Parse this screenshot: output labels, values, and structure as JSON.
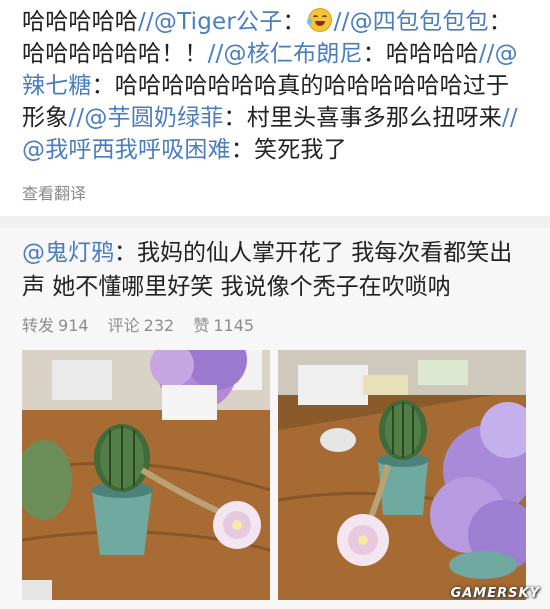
{
  "thread": {
    "parts": [
      {
        "type": "text",
        "value": "哈哈哈哈哈"
      },
      {
        "type": "sep",
        "value": "//"
      },
      {
        "type": "mention",
        "value": "@Tiger公子"
      },
      {
        "type": "text",
        "value": "："
      },
      {
        "type": "emoji",
        "value": "laugh-cry"
      },
      {
        "type": "sep",
        "value": "//"
      },
      {
        "type": "mention",
        "value": "@四包包包包"
      },
      {
        "type": "text",
        "value": "：哈哈哈哈哈哈！！"
      },
      {
        "type": "sep",
        "value": "//"
      },
      {
        "type": "mention",
        "value": "@核仁布朗尼"
      },
      {
        "type": "text",
        "value": "：哈哈哈哈"
      },
      {
        "type": "sep",
        "value": "//"
      },
      {
        "type": "mention",
        "value": "@辣七糖"
      },
      {
        "type": "text",
        "value": "：哈哈哈哈哈哈哈真的哈哈哈哈哈哈过于形象"
      },
      {
        "type": "sep",
        "value": "//"
      },
      {
        "type": "mention",
        "value": "@芋圆奶绿菲"
      },
      {
        "type": "text",
        "value": "：村里头喜事多那么扭呀来"
      },
      {
        "type": "sep",
        "value": "//"
      },
      {
        "type": "mention",
        "value": "@我呼西我呼吸困难"
      },
      {
        "type": "text",
        "value": "：笑死我了"
      }
    ],
    "translate_label": "查看翻译"
  },
  "repost": {
    "author": "@鬼灯鸦",
    "text": "：我妈的仙人掌开花了 我每次看都笑出声 她不懂哪里好笑 我说像个秃子在吹唢呐",
    "stats": {
      "repost_label": "转发",
      "repost_count": "914",
      "comment_label": "评论",
      "comment_count": "232",
      "like_label": "赞",
      "like_count": "1145"
    }
  },
  "watermark": "GAMERSKY",
  "colors": {
    "mention": "#4a7dbf",
    "meta_gray": "#8d8d8d",
    "repost_bg": "#f7f7f7"
  }
}
